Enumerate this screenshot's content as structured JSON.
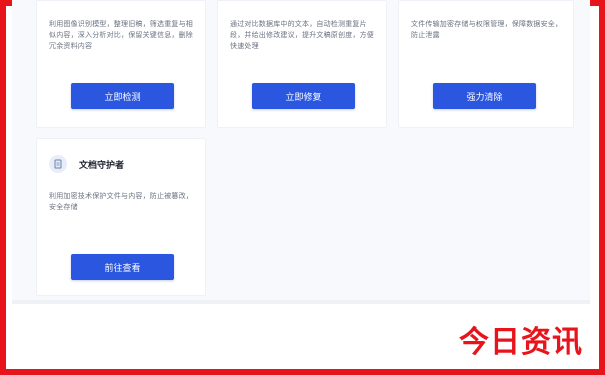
{
  "cards": [
    {
      "desc": "利用图像识别模型，整理旧稿，筛选重复与相似内容，深入分析对比，保留关键信息，删除冗余资料内容",
      "button": "立即检测"
    },
    {
      "desc": "通过对比数据库中的文本，自动检测重复片段，并给出修改建议，提升文稿原创度，方便快速处理",
      "button": "立即修复"
    },
    {
      "desc": "文件传输加密存储与权限管理，保障数据安全，防止泄露",
      "button": "强力清除"
    },
    {
      "title": "文档守护者",
      "icon": "document-icon",
      "desc": "利用加密技术保护文件与内容，防止被篡改，安全存储",
      "button": "前往查看"
    }
  ],
  "watermark": "今日资讯",
  "colors": {
    "frame": "#e8141b",
    "button": "#2a56e0",
    "watermark": "#e8141b"
  }
}
